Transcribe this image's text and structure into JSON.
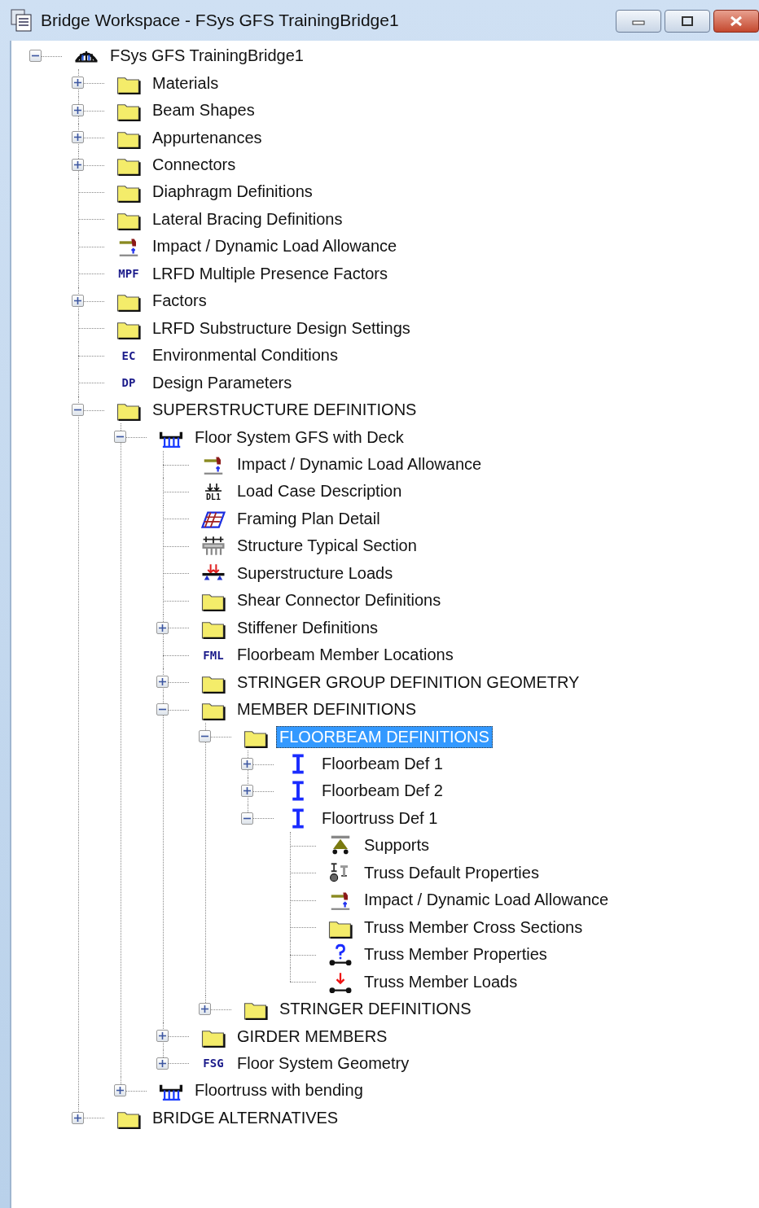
{
  "window": {
    "title": "Bridge Workspace - FSys GFS TrainingBridge1"
  },
  "tree": [
    {
      "label": "FSys GFS TrainingBridge1",
      "kind": "bridge",
      "expanded": true,
      "selected": false,
      "children": [
        {
          "label": "Materials",
          "kind": "folder",
          "expanded": false,
          "selected": false
        },
        {
          "label": "Beam Shapes",
          "kind": "folder",
          "expanded": false,
          "selected": false
        },
        {
          "label": "Appurtenances",
          "kind": "folder",
          "expanded": false,
          "selected": false
        },
        {
          "label": "Connectors",
          "kind": "folder",
          "expanded": false,
          "selected": false
        },
        {
          "label": "Diaphragm Definitions",
          "kind": "folder",
          "selected": false
        },
        {
          "label": "Lateral Bracing Definitions",
          "kind": "folder",
          "selected": false
        },
        {
          "label": "Impact / Dynamic Load Allowance",
          "kind": "impact",
          "selected": false
        },
        {
          "label": "LRFD Multiple Presence Factors",
          "kind": "text",
          "icon_text": "MPF",
          "selected": false
        },
        {
          "label": "Factors",
          "kind": "folder",
          "expanded": false,
          "selected": false
        },
        {
          "label": "LRFD Substructure Design Settings",
          "kind": "folder",
          "selected": false
        },
        {
          "label": "Environmental Conditions",
          "kind": "text",
          "icon_text": "EC",
          "selected": false
        },
        {
          "label": "Design Parameters",
          "kind": "text",
          "icon_text": "DP",
          "selected": false
        },
        {
          "label": "SUPERSTRUCTURE DEFINITIONS",
          "kind": "folder",
          "expanded": true,
          "selected": false,
          "children": [
            {
              "label": "Floor System GFS with Deck",
              "kind": "floor-system",
              "expanded": true,
              "selected": false,
              "children": [
                {
                  "label": "Impact / Dynamic Load Allowance",
                  "kind": "impact",
                  "selected": false
                },
                {
                  "label": "Load Case Description",
                  "kind": "load-case",
                  "icon_text": "DL1",
                  "selected": false
                },
                {
                  "label": "Framing Plan Detail",
                  "kind": "framing-plan",
                  "selected": false
                },
                {
                  "label": "Structure Typical Section",
                  "kind": "typical-section",
                  "selected": false
                },
                {
                  "label": "Superstructure Loads",
                  "kind": "super-loads",
                  "selected": false
                },
                {
                  "label": "Shear Connector Definitions",
                  "kind": "folder",
                  "selected": false
                },
                {
                  "label": "Stiffener Definitions",
                  "kind": "folder",
                  "expanded": false,
                  "selected": false
                },
                {
                  "label": "Floorbeam Member Locations",
                  "kind": "text",
                  "icon_text": "FML",
                  "selected": false
                },
                {
                  "label": "STRINGER GROUP DEFINITION GEOMETRY",
                  "kind": "folder",
                  "expanded": false,
                  "selected": false
                },
                {
                  "label": "MEMBER DEFINITIONS",
                  "kind": "folder",
                  "expanded": true,
                  "selected": false,
                  "children": [
                    {
                      "label": "FLOORBEAM DEFINITIONS",
                      "kind": "folder",
                      "expanded": true,
                      "selected": true,
                      "children": [
                        {
                          "label": "Floorbeam Def 1",
                          "kind": "ibeam",
                          "expanded": false,
                          "selected": false
                        },
                        {
                          "label": "Floorbeam Def 2",
                          "kind": "ibeam",
                          "expanded": false,
                          "selected": false
                        },
                        {
                          "label": "Floortruss Def 1",
                          "kind": "ibeam",
                          "expanded": true,
                          "selected": false,
                          "children": [
                            {
                              "label": "Supports",
                              "kind": "supports",
                              "selected": false
                            },
                            {
                              "label": "Truss Default Properties",
                              "kind": "truss-default",
                              "selected": false
                            },
                            {
                              "label": "Impact / Dynamic Load Allowance",
                              "kind": "impact",
                              "selected": false
                            },
                            {
                              "label": "Truss Member Cross Sections",
                              "kind": "folder",
                              "selected": false
                            },
                            {
                              "label": "Truss Member Properties",
                              "kind": "truss-props",
                              "selected": false
                            },
                            {
                              "label": "Truss Member Loads",
                              "kind": "truss-loads",
                              "selected": false
                            }
                          ]
                        }
                      ]
                    },
                    {
                      "label": "STRINGER DEFINITIONS",
                      "kind": "folder",
                      "expanded": false,
                      "selected": false
                    }
                  ]
                },
                {
                  "label": "GIRDER MEMBERS",
                  "kind": "folder",
                  "expanded": false,
                  "selected": false
                },
                {
                  "label": "Floor System Geometry",
                  "kind": "text",
                  "icon_text": "FSG",
                  "expanded": false,
                  "selected": false
                }
              ]
            },
            {
              "label": "Floortruss with bending",
              "kind": "floor-system",
              "expanded": false,
              "selected": false
            }
          ]
        },
        {
          "label": "BRIDGE ALTERNATIVES",
          "kind": "folder",
          "expanded": false,
          "selected": false
        }
      ]
    }
  ]
}
